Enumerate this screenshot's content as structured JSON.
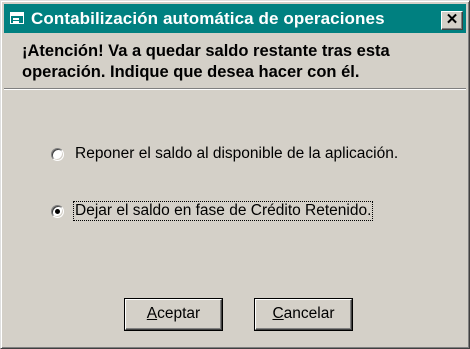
{
  "window": {
    "title": "Contabilización automática de operaciones",
    "close_symbol": "✕",
    "icon": "window-app-icon"
  },
  "message": {
    "line1": "¡Atención! Va a quedar saldo restante tras esta",
    "line2": "operación. Indique que desea hacer con él."
  },
  "options": [
    {
      "label": "Reponer el saldo al  disponible de la aplicación.",
      "selected": false
    },
    {
      "label": "Dejar el saldo en fase de Crédito Retenido.",
      "selected": true
    }
  ],
  "buttons": {
    "accept": {
      "mnemonic": "A",
      "rest": "ceptar"
    },
    "cancel": {
      "mnemonic": "C",
      "rest": "ancelar"
    }
  },
  "colors": {
    "titlebar": "#008080",
    "face": "#d4d0c8"
  }
}
